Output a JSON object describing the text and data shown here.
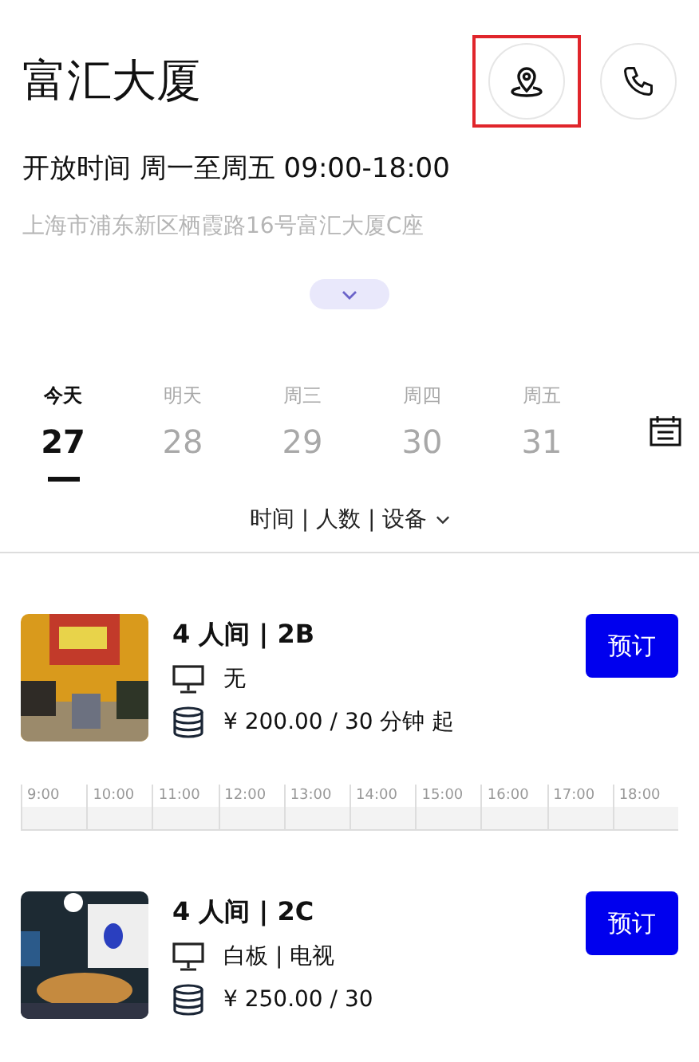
{
  "header": {
    "title": "富汇大厦",
    "hours": "开放时间 周一至周五 09:00-18:00",
    "address": "上海市浦东新区栖霞路16号富汇大厦C座",
    "location_button": {
      "highlighted": true
    }
  },
  "dates": [
    {
      "weekday": "今天",
      "day": "27",
      "selected": true
    },
    {
      "weekday": "明天",
      "day": "28",
      "selected": false
    },
    {
      "weekday": "周三",
      "day": "29",
      "selected": false
    },
    {
      "weekday": "周四",
      "day": "30",
      "selected": false
    },
    {
      "weekday": "周五",
      "day": "31",
      "selected": false
    }
  ],
  "filter": "时间 | 人数 | 设备",
  "rooms": [
    {
      "name": "4 人间 | 2B",
      "equipment": "无",
      "price": "¥ 200.00 / 30 分钟 起",
      "button": "预订",
      "timeline": [
        "9:00",
        "10:00",
        "11:00",
        "12:00",
        "13:00",
        "14:00",
        "15:00",
        "16:00",
        "17:00",
        "18:00"
      ]
    },
    {
      "name": "4 人间 | 2C",
      "equipment": "白板 | 电视",
      "price": "¥ 250.00 / 30",
      "button": "预订"
    }
  ]
}
